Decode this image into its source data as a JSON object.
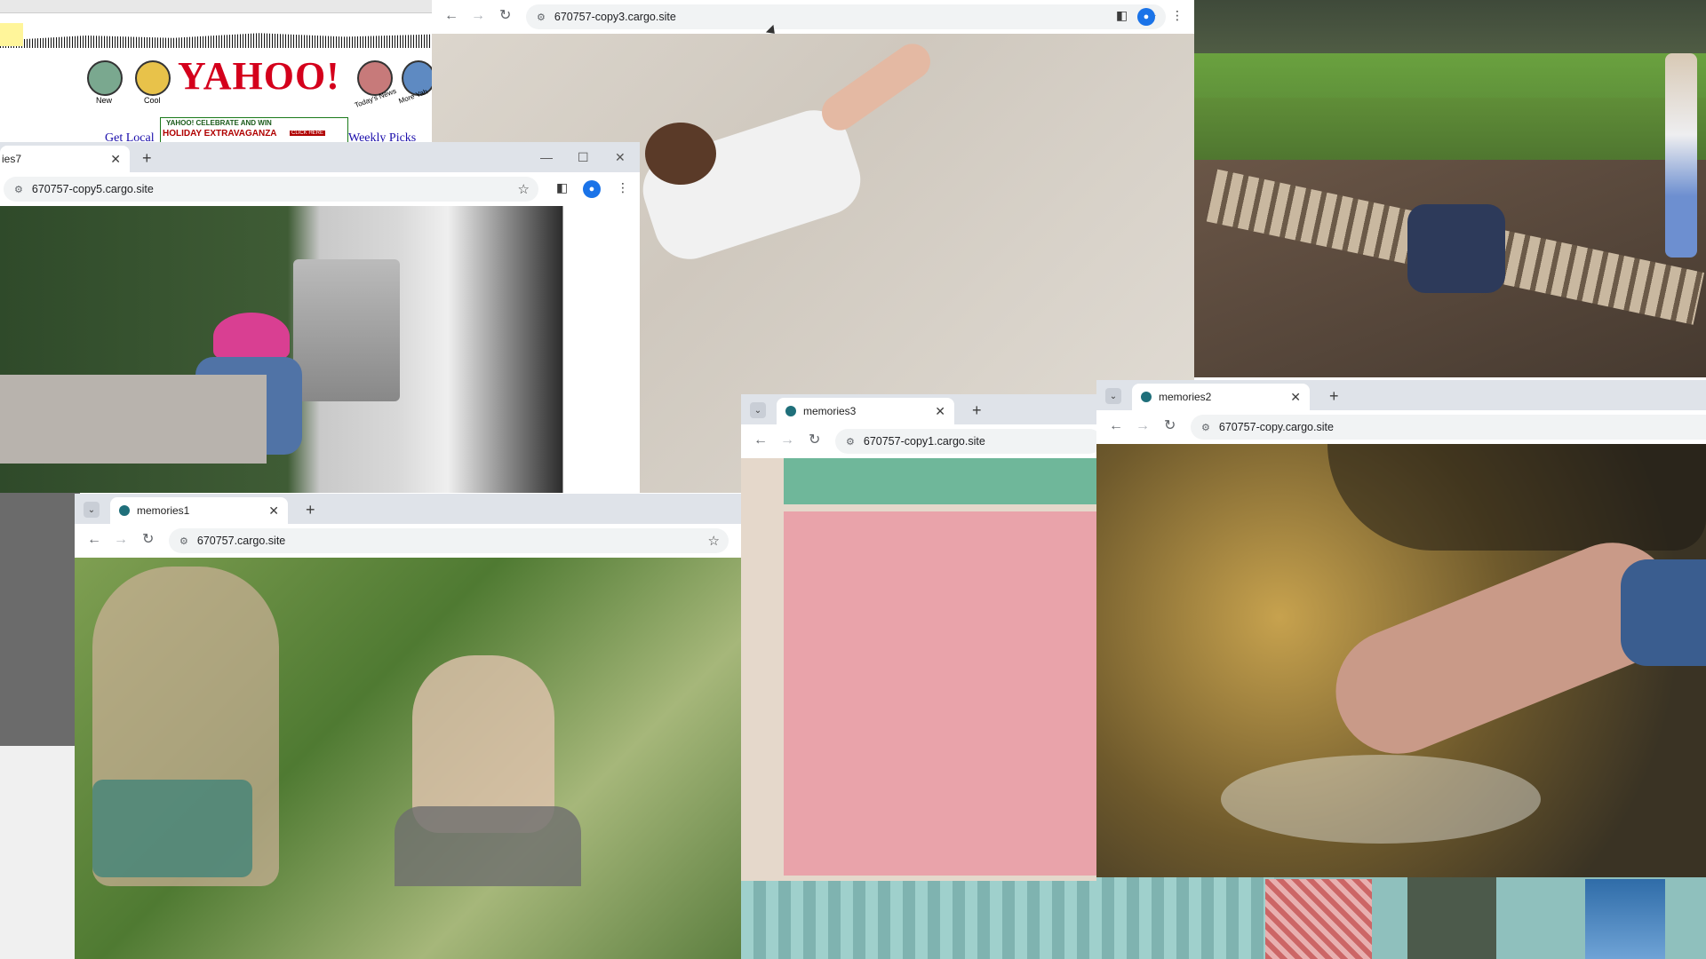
{
  "colors": {
    "tabbar_bg": "#dfe3e9",
    "omnibox_bg": "#f1f3f4",
    "favicon": "#1f6f7a",
    "yahoo_red": "#d4001c",
    "yahoo_link": "#1a0dab"
  },
  "yahoo_page": {
    "logo": "YAHOO!",
    "icons": [
      {
        "icon": "new-icon",
        "label": "New"
      },
      {
        "icon": "cool-icon",
        "label": "Cool"
      },
      {
        "icon": "todays-news-icon",
        "label": "Today's News"
      },
      {
        "icon": "more-yahoo-icon",
        "label": "More Yah"
      }
    ],
    "banner_top": "YAHOO! CELEBRATE AND WIN",
    "banner_main": "HOLIDAY EXTRAVAGANZA",
    "banner_click": "CLICK HERE",
    "links": [
      "Get Local",
      "Weekly Picks"
    ]
  },
  "windows": {
    "copy3": {
      "url": "670757-copy3.cargo.site",
      "nav": {
        "back": "←",
        "forward": "→",
        "reload": "↻"
      },
      "photo_desc": "child lying on sand"
    },
    "copy5": {
      "tab_label": "ies7",
      "url": "670757-copy5.cargo.site",
      "photo_desc": "children on tricycle with helmets"
    },
    "memories3": {
      "tab_label": "memories3",
      "url": "670757-copy1.cargo.site",
      "photo_desc": "pink wall"
    },
    "memories2": {
      "tab_label": "memories2",
      "url": "670757-copy.cargo.site",
      "photo_desc": "feet in creek water"
    },
    "memories1": {
      "tab_label": "memories1",
      "url": "670757.cargo.site",
      "photo_desc": "children eating in garden"
    }
  },
  "glyphs": {
    "close": "✕",
    "plus": "+",
    "star": "☆",
    "tune": "⚙",
    "menu": "⋮",
    "sidepanel": "◧",
    "profile": "●",
    "chevron": "⌄",
    "minimize": "—",
    "maximize": "☐",
    "back": "←",
    "forward": "→",
    "reload": "↻"
  }
}
